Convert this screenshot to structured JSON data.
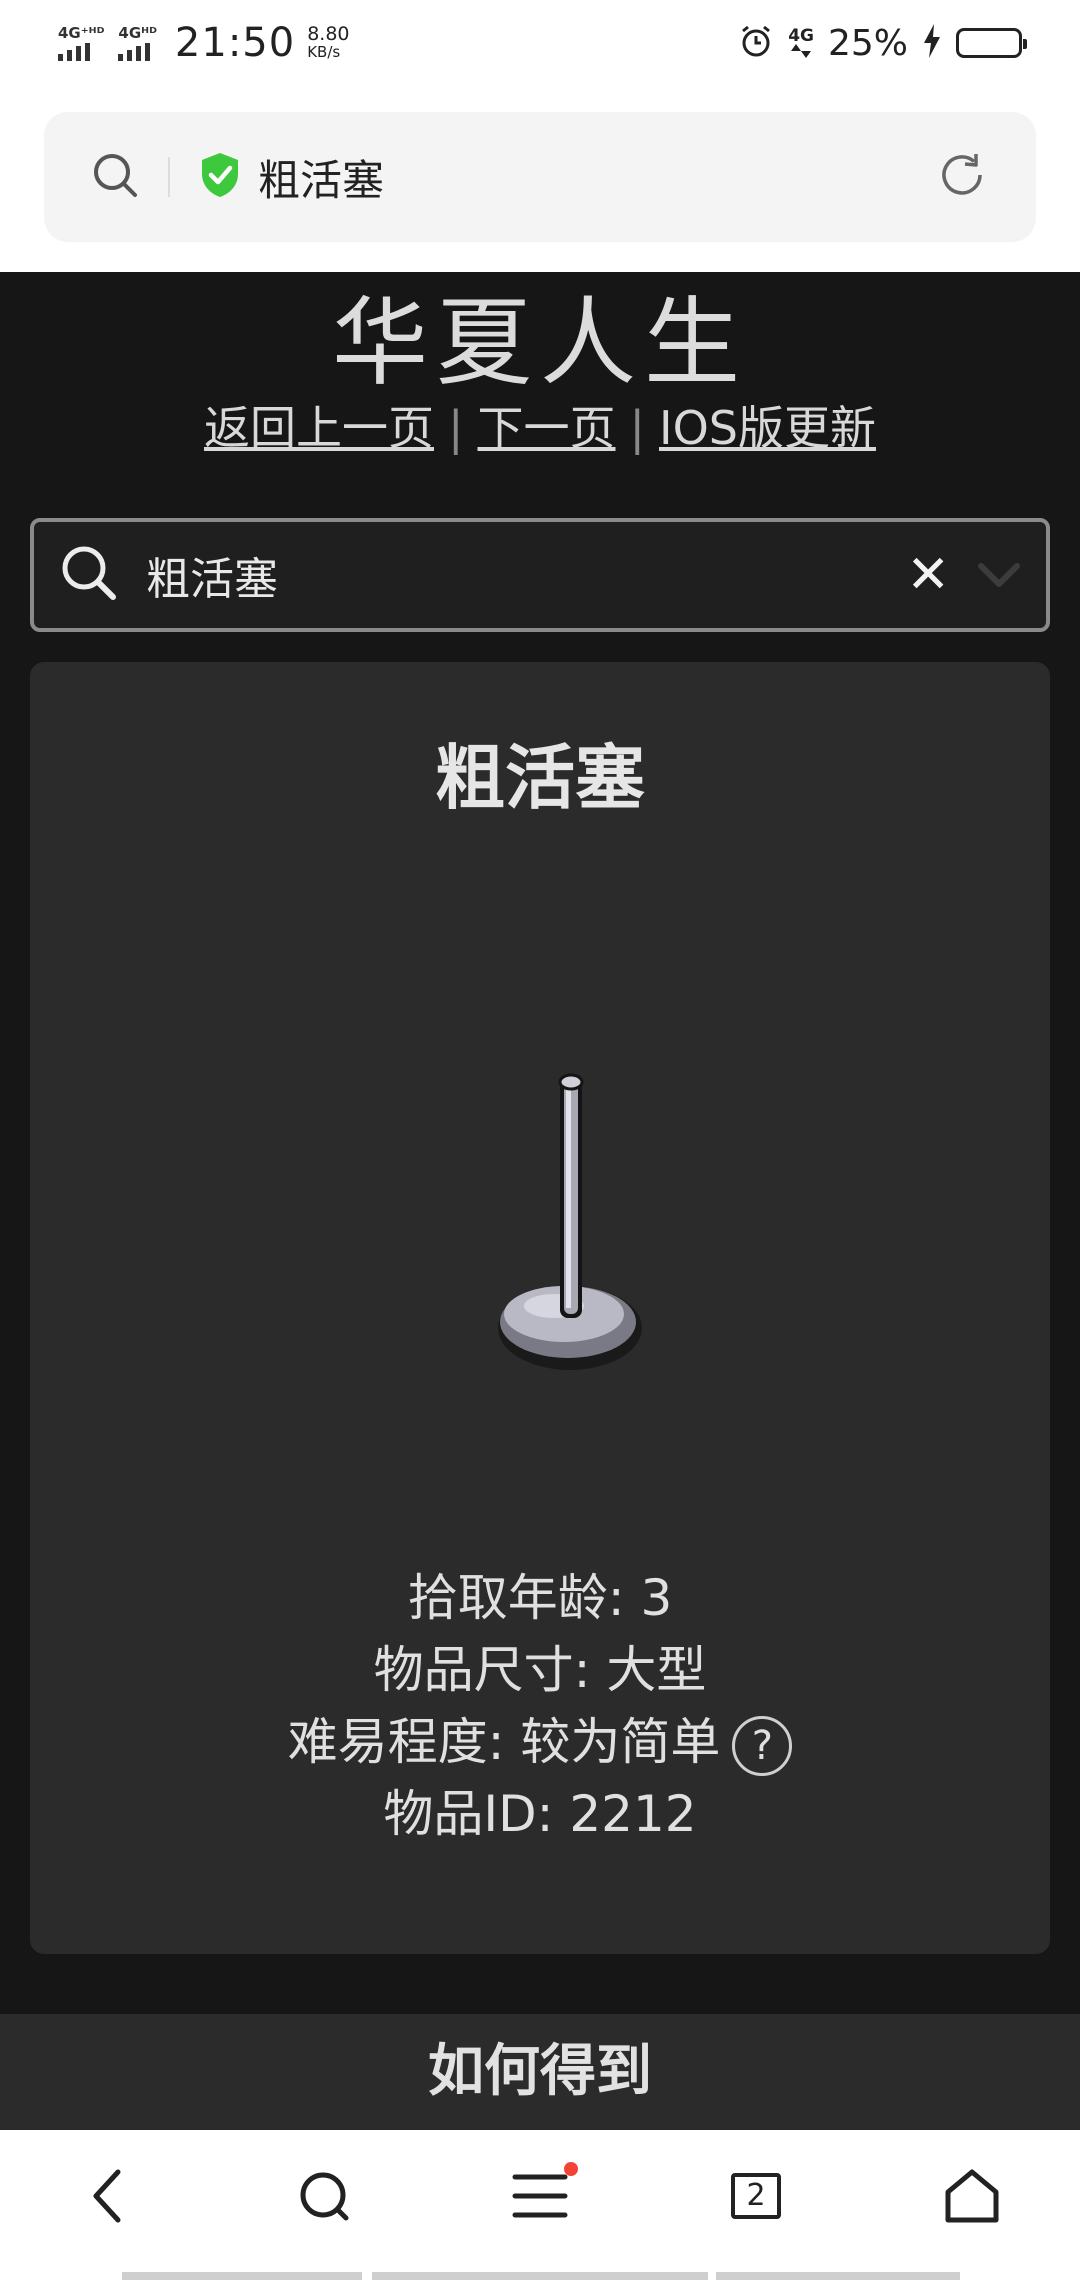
{
  "status_bar": {
    "net1": "4G⁺ᴴᴰ",
    "net2": "4Gᴴᴰ",
    "time": "21:50",
    "speed_value": "8.80",
    "speed_unit": "KB/s",
    "net3": "4G",
    "battery_percent": "25%",
    "battery_level": 0.25,
    "charging": true
  },
  "browser": {
    "url_title": "粗活塞",
    "secure": true,
    "tab_count": "2",
    "menu_has_notification": true
  },
  "page": {
    "site_title": "华夏人生",
    "nav": {
      "back": "返回上一页",
      "next": "下一页",
      "ios": "IOS版更新",
      "separator": "|"
    },
    "search": {
      "value": "粗活塞",
      "clear_label": "✕"
    },
    "item": {
      "title": "粗活塞",
      "pickup_age": "拾取年龄: 3",
      "size": "物品尺寸: 大型",
      "difficulty": "难易程度: 较为简单",
      "help_label": "?",
      "item_id": "物品ID: 2212"
    },
    "section_heading": "如何得到"
  },
  "colors": {
    "page_bg": "#161616",
    "card_bg": "#2b2b2b",
    "secure_shield": "#3ec83e",
    "notification_dot": "#f24336"
  }
}
